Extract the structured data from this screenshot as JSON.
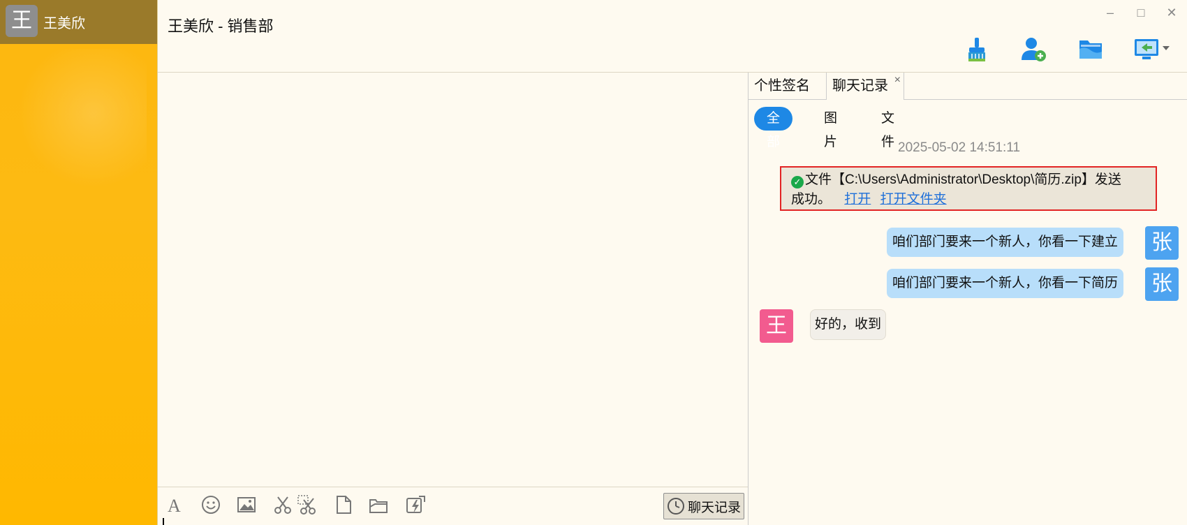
{
  "sidebar": {
    "avatar_char": "王",
    "name": "王美欣"
  },
  "header": {
    "title": "王美欣 - 销售部"
  },
  "window": {
    "minimize": "–",
    "maximize": "□",
    "close": "✕"
  },
  "toolbar": {
    "icons": [
      "brush-icon",
      "add-contact-icon",
      "folder-icon",
      "remote-desktop-icon"
    ]
  },
  "compose": {
    "tools": [
      "font-icon",
      "emoji-icon",
      "image-icon",
      "scissors-icon",
      "screenshot-icon",
      "file-icon",
      "folder-send-icon",
      "flash-icon"
    ],
    "history_label": "聊天记录"
  },
  "tabs": [
    {
      "label": "个性签名"
    },
    {
      "label": "聊天记录",
      "close": "×"
    }
  ],
  "filters": [
    {
      "label": "全部"
    },
    {
      "label": "图片"
    },
    {
      "label": "文件"
    }
  ],
  "history": {
    "timestamp": "2025-05-02 14:51:11",
    "notice": {
      "text_line1": "文件【C:\\Users\\Administrator\\Desktop\\简历.zip】发送",
      "text_line2": "成功。",
      "open": "打开",
      "open_folder": "打开文件夹"
    },
    "messages": [
      {
        "side": "right",
        "avatar": "张",
        "text": "咱们部门要来一个新人，你看一下建立"
      },
      {
        "side": "right",
        "avatar": "张",
        "text": "咱们部门要来一个新人，你看一下简历"
      },
      {
        "side": "left",
        "avatar": "王",
        "text": "好的，收到"
      }
    ]
  },
  "colors": {
    "accent": "#1e88e5",
    "sidebar": "#fdb70f",
    "highlight_border": "#e22424"
  }
}
